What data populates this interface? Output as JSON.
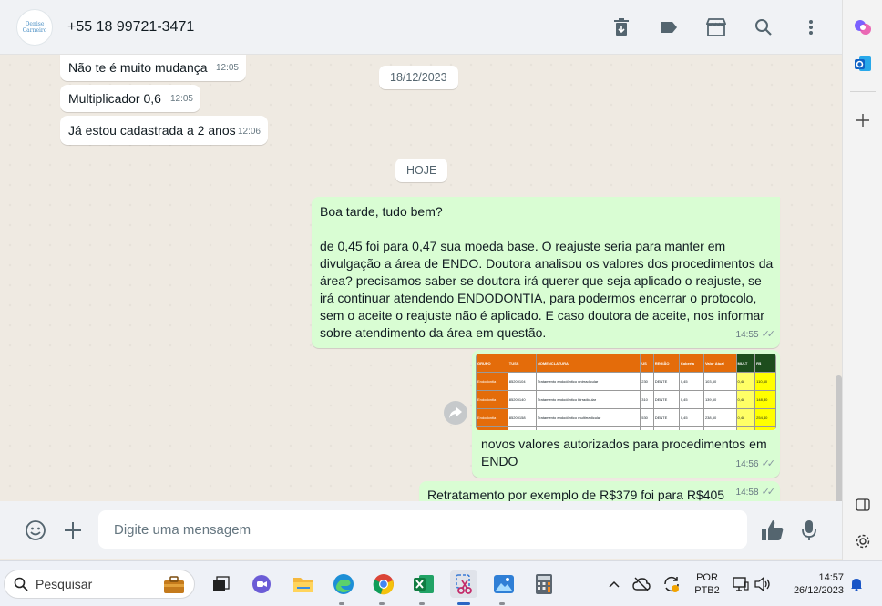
{
  "header": {
    "avatar_text": "Denise Carneiro",
    "contact": "+55 18 99721-3471"
  },
  "messages": {
    "m1_text": "Não te é muito mudança",
    "m1_time": "12:05",
    "m2_text": "Multiplicador 0,6",
    "m2_time": "12:05",
    "m3_text": "Já estou cadastrada a 2 anos",
    "m3_time": "12:06",
    "date_pill": "18/12/2023",
    "today_pill": "HOJE",
    "m4_line1": "Boa tarde, tudo bem?",
    "m4_body": "de 0,45 foi para 0,47 sua moeda base. O reajuste seria para manter em divulgação a área de ENDO. Doutora analisou os valores dos procedimentos da área? precisamos saber se doutora irá querer que seja aplicado o reajuste, se irá continuar atendendo ENDODONTIA, para podermos encerrar o protocolo, sem o aceite o reajuste não é aplicado. E caso doutora de aceite, nos informar sobre atendimento da área em questão.",
    "m4_time": "14:55",
    "m5_caption": "novos valores autorizados para procedimentos em ENDO",
    "m5_time": "14:56",
    "m6_text": "Retratamento por exemplo de R$379 foi para R$405",
    "m6_time": "14:58"
  },
  "image_table": {
    "headers": [
      "GRUPO",
      "TUSS",
      "NOMENCLATURA",
      "US",
      "REGIÃO",
      "Coberta",
      "Valor Atual",
      "MULT",
      "R$"
    ],
    "rows": [
      [
        "Endodontia",
        "85200104",
        "Tratamento endodôntico unirradicular",
        "230",
        "DENTE",
        "0,45",
        "103,50",
        "0,48",
        "110,40"
      ],
      [
        "Endodontia",
        "85200140",
        "Tratamento endodôntico birradicular",
        "310",
        "DENTE",
        "0,45",
        "139,50",
        "0,48",
        "148,80"
      ],
      [
        "Endodontia",
        "85200158",
        "Tratamento endodôntico multirradicular",
        "530",
        "DENTE",
        "0,45",
        "238,50",
        "0,48",
        "254,40"
      ],
      [
        "Endodontia",
        "85200115",
        "Retratamento endodôntico unirradicular",
        "395",
        "DENTE",
        "0,45",
        "177,75",
        "0,48",
        "189,60"
      ],
      [
        "Endodontia",
        "85200060",
        "Retratamento endodôntico birradicular",
        "560",
        "DENTE",
        "0,45",
        "252,00",
        "0,48",
        "268,80"
      ],
      [
        "Endodontia",
        "85200107",
        "Retratamento endodôntico multirradicular",
        "844",
        "DENTE",
        "0,45",
        "379,80",
        "0,48",
        "405,12"
      ]
    ]
  },
  "composer": {
    "placeholder": "Digite uma mensagem"
  },
  "taskbar": {
    "search_label": "Pesquisar",
    "lang_line1": "POR",
    "lang_line2": "PTB2",
    "clock_time": "14:57",
    "clock_date": "26/12/2023"
  },
  "colors": {
    "outgoing_bubble": "#d9fdd3",
    "incoming_bubble": "#ffffff",
    "chat_background": "#efeae2"
  }
}
